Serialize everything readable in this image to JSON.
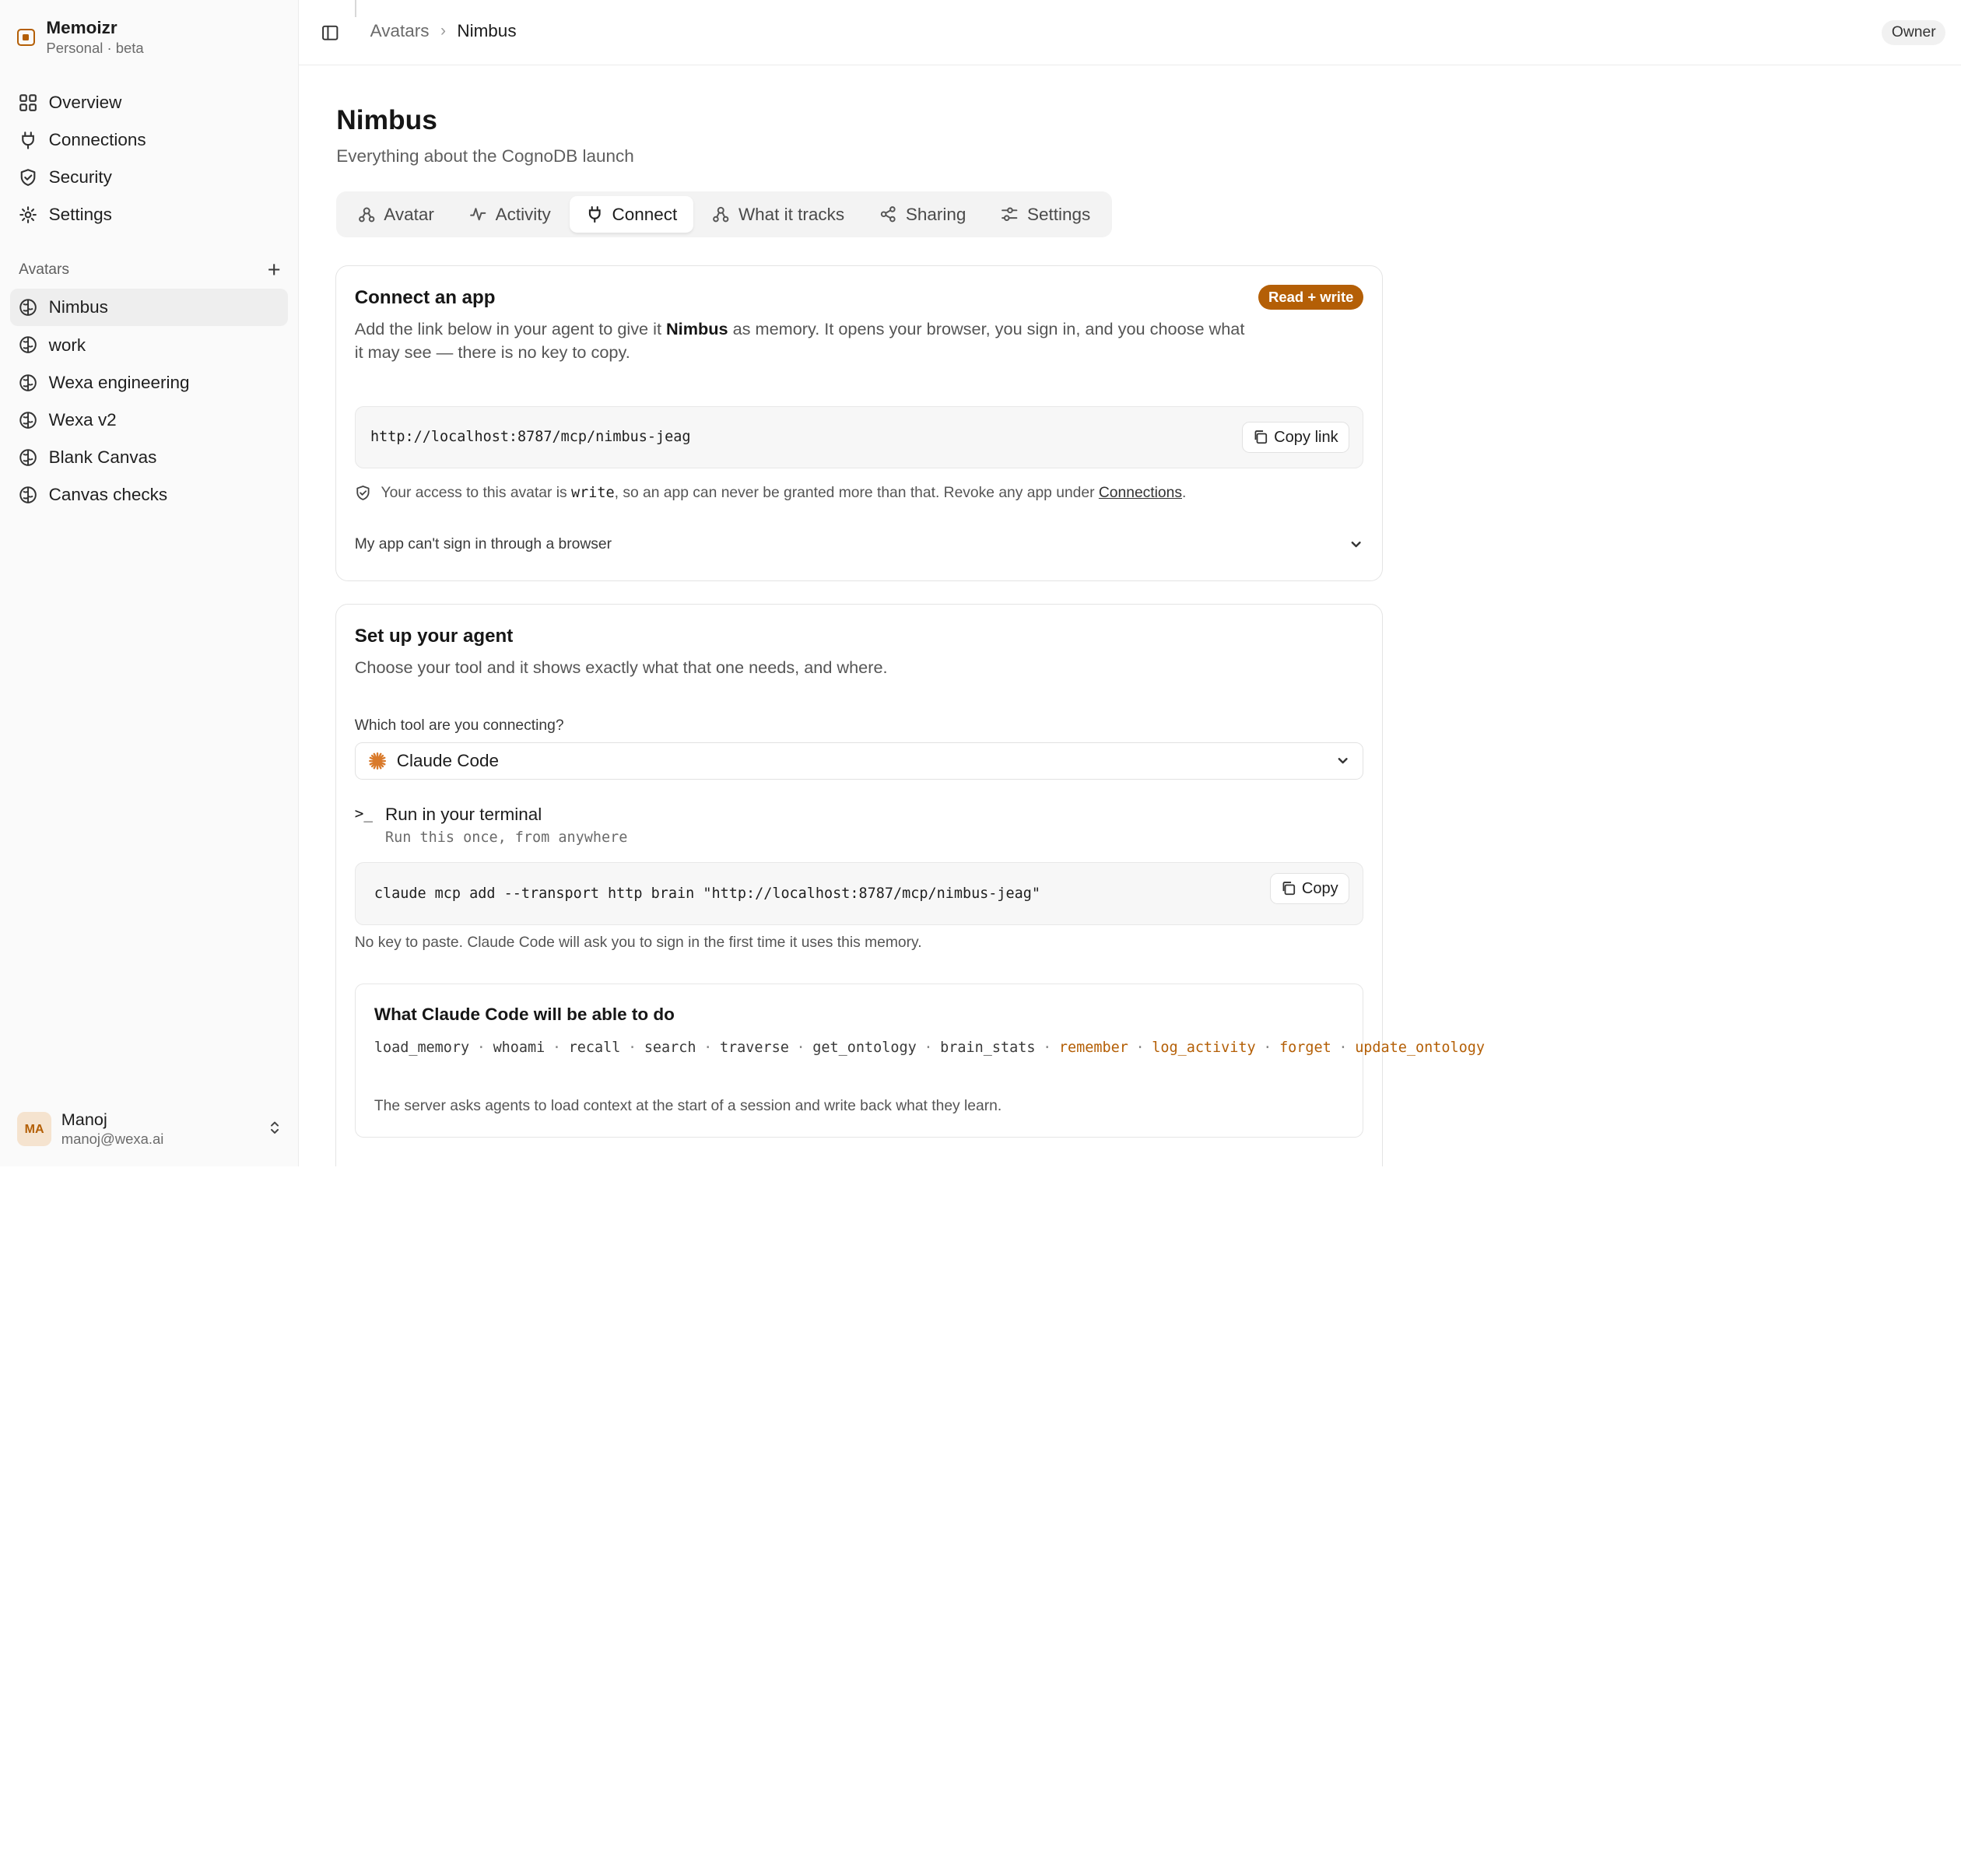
{
  "brand": {
    "name": "Memoizr",
    "subtitle": "Personal · beta"
  },
  "nav": {
    "items": [
      {
        "label": "Overview",
        "icon": "grid-icon"
      },
      {
        "label": "Connections",
        "icon": "plug-icon"
      },
      {
        "label": "Security",
        "icon": "shield-icon"
      },
      {
        "label": "Settings",
        "icon": "gear-icon"
      }
    ]
  },
  "avatars": {
    "heading": "Avatars",
    "items": [
      {
        "label": "Nimbus"
      },
      {
        "label": "work"
      },
      {
        "label": "Wexa engineering"
      },
      {
        "label": "Wexa v2"
      },
      {
        "label": "Blank Canvas"
      },
      {
        "label": "Canvas checks"
      }
    ]
  },
  "user": {
    "initials": "MA",
    "name": "Manoj",
    "email": "manoj@wexa.ai"
  },
  "topbar": {
    "crumb_root": "Avatars",
    "crumb_current": "Nimbus",
    "role": "Owner"
  },
  "page": {
    "title": "Nimbus",
    "subtitle": "Everything about the CognoDB launch"
  },
  "tabs": [
    {
      "label": "Avatar"
    },
    {
      "label": "Activity"
    },
    {
      "label": "Connect"
    },
    {
      "label": "What it tracks"
    },
    {
      "label": "Sharing"
    },
    {
      "label": "Settings"
    }
  ],
  "connect_card": {
    "title": "Connect an app",
    "badge": "Read + write",
    "desc_before": "Add the link below in your agent to give it ",
    "desc_bold": "Nimbus",
    "desc_after": " as memory. It opens your browser, you sign in, and you choose what it may see — there is no key to copy.",
    "url": "http://localhost:8787/mcp/nimbus-jeag",
    "copy_label": "Copy link",
    "access_before": "Your access to this avatar is ",
    "access_level": "write",
    "access_after": ", so an app can never be granted more than that. Revoke any app under ",
    "access_link": "Connections",
    "access_end": ".",
    "expander_label": "My app can't sign in through a browser"
  },
  "setup_card": {
    "title": "Set up your agent",
    "desc": "Choose your tool and it shows exactly what that one needs, and where.",
    "field_label": "Which tool are you connecting?",
    "selected_tool": "Claude Code",
    "step_icon": ">_",
    "step_title": "Run in your terminal",
    "step_sub": "Run this once, from anywhere",
    "command": "claude mcp add --transport http brain \"http://localhost:8787/mcp/nimbus-jeag\"",
    "copy_label": "Copy",
    "hint": "No key to paste. Claude Code will ask you to sign in the first time it uses this memory.",
    "tools_title": "What Claude Code will be able to do",
    "tools_read": [
      "load_memory",
      "whoami",
      "recall",
      "search",
      "traverse",
      "get_ontology",
      "brain_stats"
    ],
    "tools_write": [
      "remember",
      "log_activity",
      "forget",
      "update_ontology"
    ],
    "tools_note": "The server asks agents to load context at the start of a session and write back what they learn."
  },
  "colors": {
    "accent": "#b45f06",
    "muted_text": "#6b6b6b",
    "border": "#e4e4e4"
  }
}
